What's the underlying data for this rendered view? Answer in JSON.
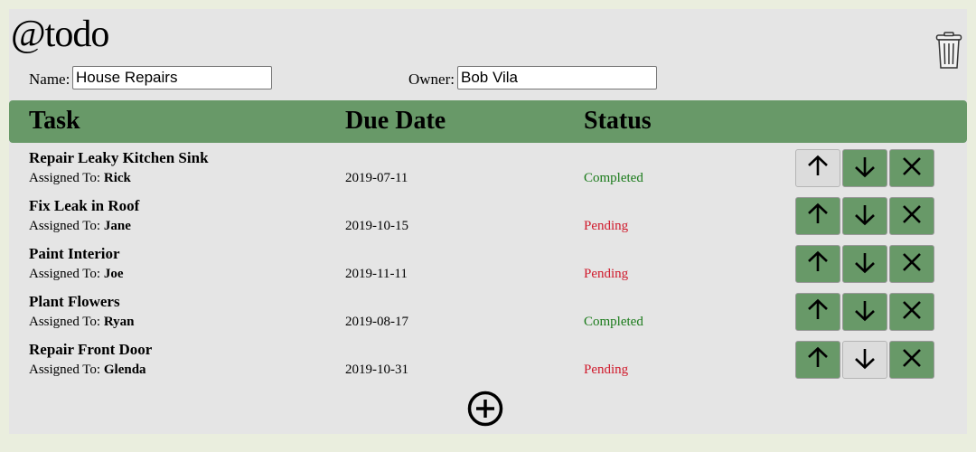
{
  "app": {
    "title": "@todo"
  },
  "icons": {
    "trash": "trash-icon",
    "up": "arrow-up-icon",
    "down": "arrow-down-icon",
    "delete": "close-icon",
    "add": "plus-circle-icon"
  },
  "colors": {
    "accent": "#689968",
    "completed": "#1a7a1a",
    "pending": "#d0192b",
    "background": "#e5e5e5"
  },
  "form": {
    "name_label": "Name:",
    "name_value": "House Repairs",
    "owner_label": "Owner:",
    "owner_value": "Bob Vila"
  },
  "table": {
    "headers": {
      "task": "Task",
      "due": "Due Date",
      "status": "Status"
    },
    "assigned_prefix": "Assigned To:",
    "rows": [
      {
        "task": "Repair Leaky Kitchen Sink",
        "assignee": "Rick",
        "due": "2019-07-11",
        "status": "Completed",
        "up_disabled": true,
        "down_disabled": false
      },
      {
        "task": "Fix Leak in Roof",
        "assignee": "Jane",
        "due": "2019-10-15",
        "status": "Pending",
        "up_disabled": false,
        "down_disabled": false
      },
      {
        "task": "Paint Interior",
        "assignee": "Joe",
        "due": "2019-11-11",
        "status": "Pending",
        "up_disabled": false,
        "down_disabled": false
      },
      {
        "task": "Plant Flowers",
        "assignee": "Ryan",
        "due": "2019-08-17",
        "status": "Completed",
        "up_disabled": false,
        "down_disabled": false
      },
      {
        "task": "Repair Front Door",
        "assignee": "Glenda",
        "due": "2019-10-31",
        "status": "Pending",
        "up_disabled": false,
        "down_disabled": true
      }
    ]
  }
}
